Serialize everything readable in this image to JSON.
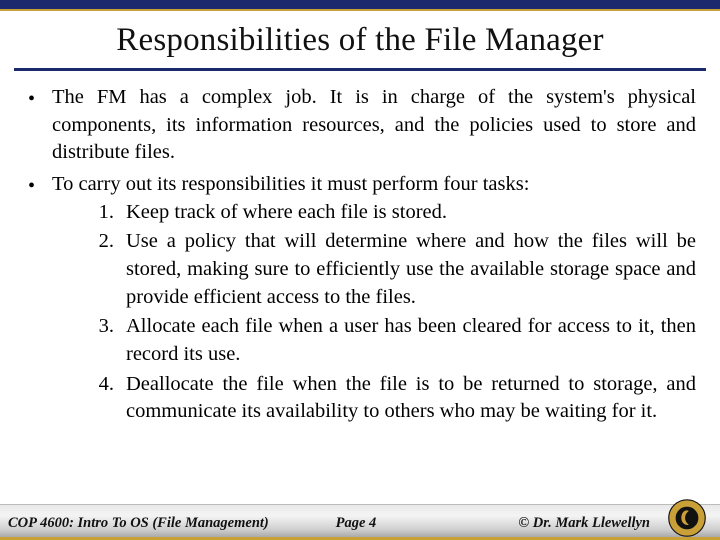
{
  "title": "Responsibilities of the File Manager",
  "bullets": [
    {
      "text": "The FM has a complex job.  It is in charge of the system's physical components, its information resources, and the policies used to store and distribute files."
    },
    {
      "text": "To carry out its responsibilities it must perform four tasks:",
      "numbered": [
        "Keep track of where each file is stored.",
        "Use a policy that will determine where and how the files will be stored, making sure to efficiently use the available storage space and provide efficient access to the files.",
        "Allocate each file when a user has been cleared for access to it, then record its use.",
        "Deallocate the file when the file is to be returned to storage, and communicate its availability to others who may be waiting for it."
      ]
    }
  ],
  "footer": {
    "course": "COP 4600: Intro To OS  (File Management)",
    "page": "Page  4",
    "author": "© Dr. Mark Llewellyn"
  }
}
